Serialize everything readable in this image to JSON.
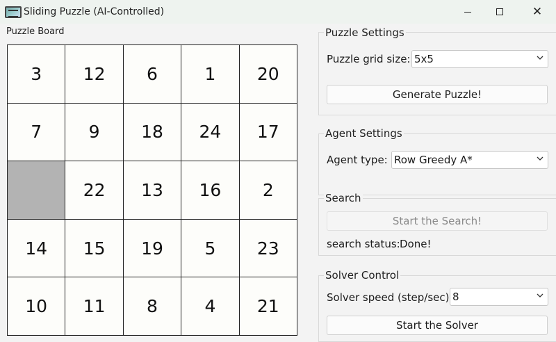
{
  "window": {
    "title": "Sliding Puzzle (AI-Controlled)"
  },
  "board": {
    "label": "Puzzle Board",
    "tiles": [
      "3",
      "12",
      "6",
      "1",
      "20",
      "7",
      "9",
      "18",
      "24",
      "17",
      "",
      "22",
      "13",
      "16",
      "2",
      "14",
      "15",
      "19",
      "5",
      "23",
      "10",
      "11",
      "8",
      "4",
      "21"
    ]
  },
  "puzzle_settings": {
    "title": "Puzzle Settings",
    "grid_size_label": "Puzzle grid size:",
    "grid_size_value": "5x5",
    "generate_button": "Generate Puzzle!"
  },
  "agent_settings": {
    "title": "Agent Settings",
    "agent_type_label": "Agent type:",
    "agent_type_value": "Row Greedy A*"
  },
  "search": {
    "title": "Search",
    "start_button": "Start the Search!",
    "status_label": "search status:",
    "status_value": "Done!"
  },
  "solver_control": {
    "title": "Solver Control",
    "speed_label": "Solver speed (step/sec):",
    "speed_value": "8",
    "start_button": "Start the Solver"
  },
  "colors": {
    "blank_tile": "#b3b3b3",
    "tile_bg": "#fdfdfa",
    "titlebar_bg": "#eef3ef"
  }
}
